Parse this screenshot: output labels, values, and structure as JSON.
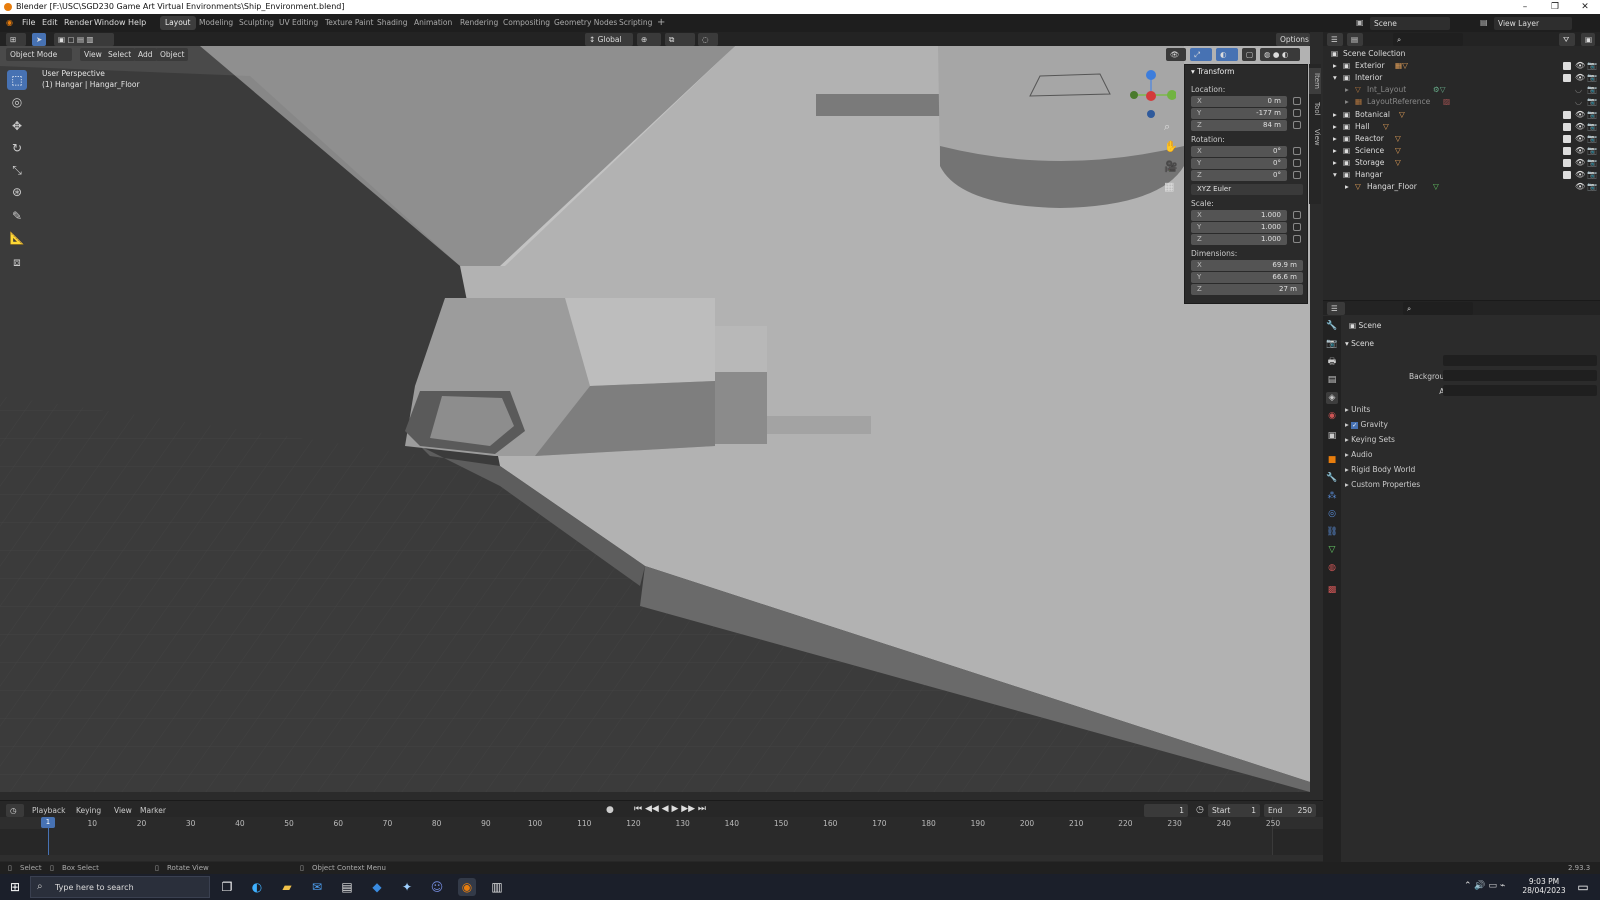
{
  "window": {
    "title": "Blender [F:\\USC\\SGD230 Game Art Virtual Environments\\Ship_Environment.blend]"
  },
  "menu": [
    "File",
    "Edit",
    "Render",
    "Window",
    "Help"
  ],
  "workspaces": [
    "Layout",
    "Modeling",
    "Sculpting",
    "UV Editing",
    "Texture Paint",
    "Shading",
    "Animation",
    "Rendering",
    "Compositing",
    "Geometry Nodes",
    "Scripting"
  ],
  "active_workspace": "Layout",
  "scene_selector": "Scene",
  "view_layer": "View Layer",
  "viewport": {
    "transform_orientation": "Global",
    "options_label": "Options",
    "mode": "Object Mode",
    "header_menus": [
      "View",
      "Select",
      "Add",
      "Object"
    ],
    "overlay_line1": "User Perspective",
    "overlay_line2": "(1) Hangar | Hangar_Floor"
  },
  "npanel": {
    "section": "Transform",
    "location_label": "Location:",
    "location": {
      "x": "0 m",
      "y": "-177 m",
      "z": "84 m"
    },
    "rotation_label": "Rotation:",
    "rotation": {
      "x": "0°",
      "y": "0°",
      "z": "0°"
    },
    "rotation_mode": "XYZ Euler",
    "scale_label": "Scale:",
    "scale": {
      "x": "1.000",
      "y": "1.000",
      "z": "1.000"
    },
    "dimensions_label": "Dimensions:",
    "dimensions": {
      "x": "69.9 m",
      "y": "66.6 m",
      "z": "27 m"
    },
    "axis": {
      "x": "X",
      "y": "Y",
      "z": "Z"
    },
    "tabs": [
      "Item",
      "Tool",
      "View"
    ]
  },
  "outliner": {
    "root": "Scene Collection",
    "items": [
      {
        "name": "Exterior"
      },
      {
        "name": "Interior"
      },
      {
        "name": "Int_Layout"
      },
      {
        "name": "LayoutReference"
      },
      {
        "name": "Botanical"
      },
      {
        "name": "Hall"
      },
      {
        "name": "Reactor"
      },
      {
        "name": "Science"
      },
      {
        "name": "Storage"
      },
      {
        "name": "Hangar"
      },
      {
        "name": "Hangar_Floor"
      }
    ]
  },
  "properties": {
    "header": "Scene",
    "section": "Scene",
    "camera_label": "Camera",
    "background_scene_label": "Background Scene",
    "active_clip_label": "Active Clip",
    "panels": [
      "Units",
      "Gravity",
      "Keying Sets",
      "Audio",
      "Rigid Body World",
      "Custom Properties"
    ],
    "gravity_checked": true
  },
  "timeline": {
    "menus": [
      "Playback",
      "Keying",
      "View",
      "Marker"
    ],
    "current_frame": "1",
    "start_label": "Start",
    "start": "1",
    "end_label": "End",
    "end": "250",
    "ticks": [
      "1",
      "10",
      "20",
      "30",
      "40",
      "50",
      "60",
      "70",
      "80",
      "90",
      "100",
      "110",
      "120",
      "130",
      "140",
      "150",
      "160",
      "170",
      "180",
      "190",
      "200",
      "210",
      "220",
      "230",
      "240",
      "250"
    ]
  },
  "statusbar": {
    "select": "Select",
    "box_select": "Box Select",
    "rotate_view": "Rotate View",
    "context_menu": "Object Context Menu",
    "version": "2.93.3"
  },
  "taskbar": {
    "search_placeholder": "Type here to search",
    "time": "9:03 PM",
    "date": "28/04/2023"
  },
  "colors": {
    "accent": "#4772b3",
    "orange": "#e87d0d",
    "viewport_light": "#b4b4b4",
    "viewport_dark": "#3c3c3c"
  }
}
